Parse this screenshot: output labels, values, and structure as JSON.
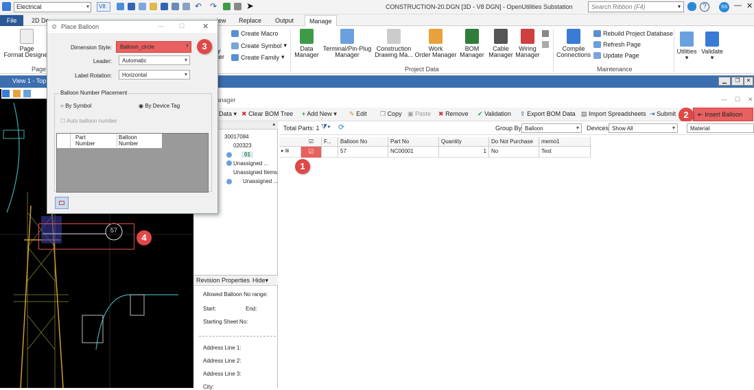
{
  "titlebar": {
    "workspace": "Electrical",
    "v8_label": "V8",
    "app_title": "CONSTRUCTION-20.DGN [3D - V8 DGN] - OpenUtilities Substation",
    "search_placeholder": "Search Ribbon (F4)",
    "user_initials": "SS"
  },
  "tabs": [
    "File",
    "2D De",
    "iew",
    "Replace",
    "Output",
    "Manage"
  ],
  "ribbon": {
    "page_format_designer": "Page\nFormat Designer",
    "page_group": "Page I",
    "create_macro": "Create Macro",
    "create_symbol": "Create Symbol",
    "create_family": "Create Family",
    "ry_ger": "ry\nger",
    "data_manager": "Data\nManager",
    "terminal_manager": "Terminal/Pin-Plug\nManager",
    "construction_drawing": "Construction\nDrawing Ma...",
    "work_order": "Work\nOrder Manager",
    "bom_manager": "BOM\nManager",
    "cable_manager": "Cable\nManager",
    "wiring_manager": "Wiring\nManager",
    "project_data_group": "Project Data",
    "compile_connections": "Compile\nConnections",
    "rebuild_db": "Rebuild Project Database",
    "refresh_page": "Refresh Page",
    "update_page": "Update Page",
    "maintenance_group": "Maintenance",
    "utilities": "Utilities",
    "validate": "Validate"
  },
  "view": {
    "title": "View 1 - Top,"
  },
  "bom": {
    "window_title": "Manager",
    "toolbar": {
      "data": "Data",
      "clear_bom_tree": "Clear BOM Tree",
      "add_new": "Add New",
      "edit": "Edit",
      "copy": "Copy",
      "paste": "Paste",
      "remove": "Remove",
      "validation": "Validation",
      "export_bom": "Export BOM Data",
      "import_spreadsheets": "Import Spreadsheets",
      "submit": "Submit",
      "insert_balloon": "Insert Balloon"
    },
    "total_parts": "Total Parts: 1",
    "group_by_label": "Group By",
    "group_by_value": "Balloon",
    "devices_label": "Devices",
    "devices_value": "Show All",
    "material": "Material",
    "tree": [
      "30017084",
      "020323",
      "01",
      "Unassigned ...",
      "Unassigned Items",
      "Unassigned ..."
    ],
    "columns": [
      "F...",
      "Balloon No",
      "Part No",
      "Quantity",
      "Do Not Purchase",
      "memo1"
    ],
    "rows": [
      {
        "balloon": "57",
        "part": "NC00001",
        "qty": "1",
        "dnp": "No",
        "memo": "Test"
      }
    ],
    "revision": {
      "title": "Revision Properties",
      "hide": "Hide",
      "allowed": "Allowed Balloon No range:",
      "start": "Start:",
      "end": "End:",
      "starting_sheet": "Starting Sheet No:",
      "addr1": "Address Line 1:",
      "addr2": "Address Line 2:",
      "addr3": "Address Line 3:",
      "city": "City:"
    }
  },
  "dialog": {
    "title": "Place Balloon",
    "dimension_style_label": "Dimension Style:",
    "dimension_style_value": "Balloon_circle",
    "leader_label": "Leader:",
    "leader_value": "Automatic",
    "label_rotation_label": "Label Rotation:",
    "label_rotation_value": "Horizontal",
    "placement_title": "Balloon Number Placement",
    "by_symbol": "By Symbol",
    "by_device_tag": "By Device Tag",
    "auto_balloon": "Auto balloon number",
    "col_part": "Part\nNumber",
    "col_balloon": "Balloon\nNumber"
  },
  "canvas": {
    "balloon_label": "57"
  },
  "callouts": [
    "1",
    "2",
    "3",
    "4"
  ],
  "colors": {
    "accent": "#2b5797",
    "highlight": "#e04848",
    "canvas_bg": "#000000"
  }
}
